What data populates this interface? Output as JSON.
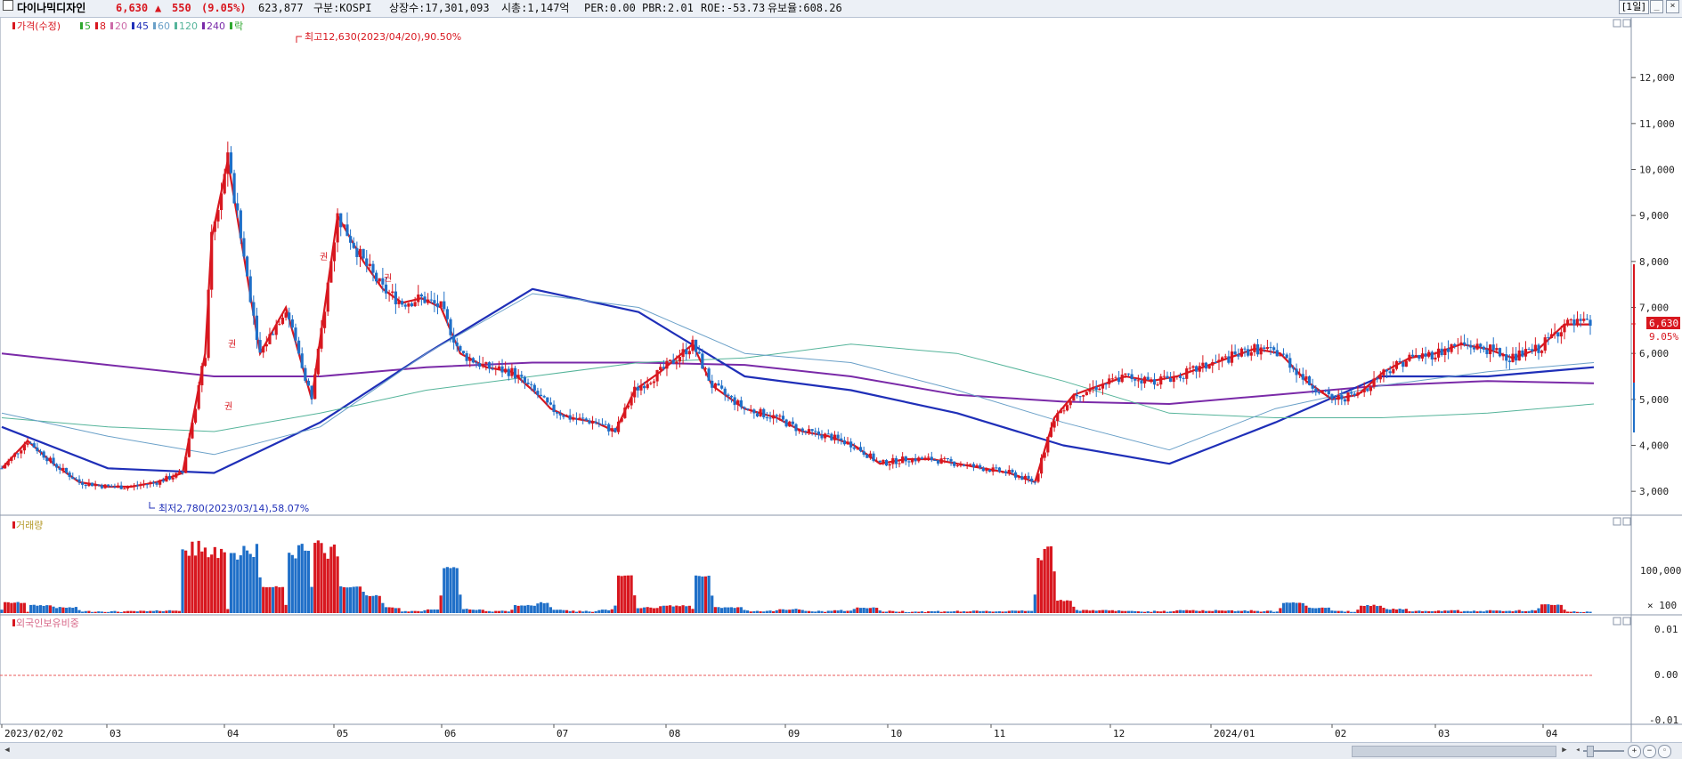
{
  "header": {
    "stock_name": "다이나믹디자인",
    "price": "6,630",
    "change_arrow": "▲",
    "change": "550",
    "change_pct": "(9.05%)",
    "volume": "623,877",
    "market": "구분:KOSPI",
    "shares": "상장수:17,301,093",
    "market_cap": "시총:1,147억",
    "per": "PER:0.00",
    "pbr": "PBR:2.01",
    "roe": "ROE:-53.73",
    "reserve": "유보율:608.26",
    "period": "[1일]"
  },
  "price_panel": {
    "legend": [
      {
        "label": "가격(수정)",
        "color": "#d8171f"
      },
      {
        "label": "5",
        "color": "#2ea82e"
      },
      {
        "label": "8",
        "color": "#d8171f"
      },
      {
        "label": "20",
        "color": "#cc6aa8"
      },
      {
        "label": "45",
        "color": "#1f2fb8"
      },
      {
        "label": "60",
        "color": "#6aa0c8"
      },
      {
        "label": "120",
        "color": "#55b49a"
      },
      {
        "label": "240",
        "color": "#7a2aa8"
      },
      {
        "label": "락",
        "color": "#2ea82e"
      }
    ],
    "high_annotation": "최고12,630(2023/04/20),90.50%",
    "low_annotation": "최저2,780(2023/03/14),58.07%",
    "current_price_tag": "6,630",
    "current_pct_tag": "9.05%",
    "y_ticks": [
      "12,000",
      "11,000",
      "10,000",
      "9,000",
      "8,000",
      "7,000",
      "6,000",
      "5,000",
      "4,000",
      "3,000"
    ],
    "rights_marks": [
      "권",
      "권",
      "권",
      "권"
    ]
  },
  "volume_panel": {
    "title": "거래량",
    "y_ticks": [
      "100,000",
      "× 100"
    ]
  },
  "foreign_panel": {
    "title": "외국인보유비중",
    "y_ticks": [
      "0.01",
      "0.00",
      "-0.01"
    ]
  },
  "x_axis": {
    "labels": [
      "2023/02/02",
      "03",
      "04",
      "05",
      "06",
      "07",
      "08",
      "09",
      "10",
      "11",
      "12",
      "2024/01",
      "02",
      "03",
      "04"
    ]
  },
  "chart_data": {
    "type": "candlestick",
    "title": "",
    "ylim": [
      2500,
      13300
    ],
    "x": [
      "2023-02",
      "2023-03",
      "2023-04",
      "2023-05",
      "2023-06",
      "2023-07",
      "2023-08",
      "2023-09",
      "2023-10",
      "2023-11",
      "2023-12",
      "2024-01",
      "2024-02",
      "2024-03",
      "2024-04"
    ],
    "close_series": {
      "name": "가격(수정)",
      "x": [
        0,
        8,
        16,
        24,
        33,
        40,
        48,
        56,
        63,
        65,
        70,
        80,
        88,
        96,
        104,
        112,
        118,
        124,
        130,
        136,
        142,
        150,
        158,
        166,
        170,
        176,
        184,
        190,
        196,
        204,
        214,
        220,
        230,
        240,
        248,
        256,
        264,
        272,
        280,
        288,
        296,
        304,
        312,
        320,
        326,
        332,
        340,
        348,
        356,
        364,
        372,
        380,
        388,
        396,
        404,
        412,
        420,
        428,
        436,
        444,
        452,
        460,
        468,
        476,
        484,
        492
      ],
      "values": [
        3500,
        4100,
        3600,
        3200,
        3100,
        3100,
        3200,
        3400,
        6000,
        8500,
        10200,
        6000,
        7000,
        5000,
        9000,
        8000,
        7400,
        7100,
        7200,
        7000,
        6000,
        5700,
        5600,
        5100,
        4800,
        4600,
        4500,
        4300,
        5200,
        5600,
        6200,
        5300,
        4800,
        4600,
        4300,
        4200,
        4000,
        3600,
        3700,
        3700,
        3600,
        3500,
        3400,
        3200,
        4600,
        5100,
        5300,
        5500,
        5400,
        5500,
        5700,
        5900,
        6100,
        6000,
        5400,
        5000,
        5100,
        5600,
        5900,
        6000,
        6200,
        6100,
        5900,
        6100,
        6630,
        6630
      ]
    },
    "ma_series": [
      {
        "name": "240",
        "color": "#7a2aa8",
        "values": [
          6000,
          5750,
          5500,
          5500,
          5700,
          5800,
          5800,
          5750,
          5500,
          5100,
          4950,
          4900,
          5100,
          5300,
          5400,
          5350
        ]
      },
      {
        "name": "45",
        "color": "#1f2fb8",
        "values": [
          4400,
          3500,
          3400,
          4500,
          6000,
          7400,
          6900,
          5500,
          5200,
          4700,
          4000,
          3600,
          4500,
          5500,
          5500,
          5700
        ]
      },
      {
        "name": "120",
        "color": "#55b49a",
        "values": [
          4600,
          4400,
          4300,
          4700,
          5200,
          5500,
          5800,
          5900,
          6200,
          6000,
          5400,
          4700,
          4600,
          4600,
          4700,
          4900
        ]
      },
      {
        "name": "60",
        "color": "#6aa0c8",
        "values": [
          4700,
          4200,
          3800,
          4400,
          6000,
          7300,
          7000,
          6000,
          5800,
          5200,
          4500,
          3900,
          4800,
          5300,
          5600,
          5800
        ]
      }
    ],
    "volume": {
      "unit": "× 100",
      "peak_approx": 170000,
      "tick": 100000
    }
  }
}
